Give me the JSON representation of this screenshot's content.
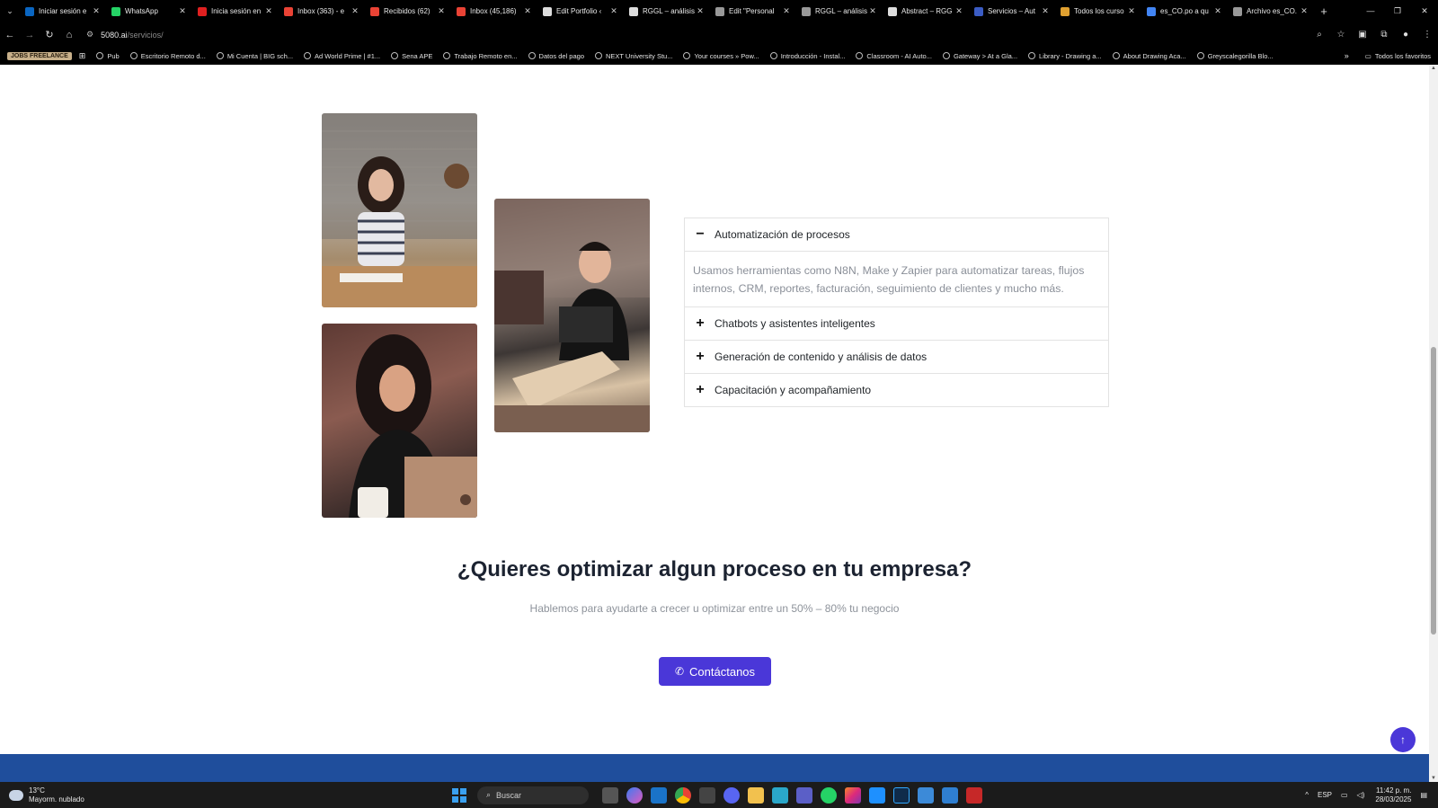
{
  "browser": {
    "tabs": [
      {
        "title": "Iniciar sesión e",
        "icon": "linkedin-icon",
        "color": "#0a66c2"
      },
      {
        "title": "WhatsApp",
        "icon": "whatsapp-icon",
        "color": "#25d366"
      },
      {
        "title": "Inicia sesión en",
        "icon": "red-logo-icon",
        "color": "#e02020"
      },
      {
        "title": "Inbox (363) - e",
        "icon": "gmail-icon",
        "color": "#ea4335"
      },
      {
        "title": "Recibidos (62)",
        "icon": "gmail-icon",
        "color": "#ea4335"
      },
      {
        "title": "Inbox (45,186)",
        "icon": "gmail-icon",
        "color": "#ea4335"
      },
      {
        "title": "Edit Portfolio ‹",
        "icon": "document-icon",
        "color": "#dddddd"
      },
      {
        "title": "RGGL – análisis",
        "icon": "document-icon",
        "color": "#dddddd"
      },
      {
        "title": "Edit \"Personal",
        "icon": "globe-icon",
        "color": "#999999"
      },
      {
        "title": "RGGL – análisis",
        "icon": "globe-icon",
        "color": "#999999"
      },
      {
        "title": "Abstract – RGG",
        "icon": "document-icon",
        "color": "#dddddd"
      },
      {
        "title": "Servicios – Aut",
        "icon": "grid-icon",
        "color": "#3b5cc4"
      },
      {
        "title": "Todos los curso",
        "icon": "course-icon",
        "color": "#e0a030"
      },
      {
        "title": "es_CO.po a qu",
        "icon": "google-icon",
        "color": "#4285f4"
      },
      {
        "title": "Archivo es_CO.",
        "icon": "globe-icon",
        "color": "#999999"
      }
    ],
    "url_host": "5080.ai",
    "url_path": "/servicios/",
    "bookmarks_badge": "JOBS FREELANCE",
    "bookmarks": [
      "Pub",
      "Escritorio Remoto d...",
      "Mi Cuenta | BIG sch...",
      "Ad World Prime | #1...",
      "Sena APE",
      "Trabajo Remoto en...",
      "Datos del pago",
      "NEXT University Stu...",
      "Your courses » Pow...",
      "Introducción - Instal...",
      "Classroom - AI Auto...",
      "Gateway > At a Gla...",
      "Library - Drawing a...",
      "About Drawing Aca...",
      "Greyscalegorilla Blo..."
    ],
    "bookmarks_all": "Todos los favoritos"
  },
  "services": {
    "items": [
      {
        "title": "Automatización de procesos",
        "sign": "−",
        "open": true,
        "body": "Usamos herramientas como N8N, Make y Zapier para automatizar tareas, flujos internos, CRM, reportes, facturación, seguimiento de clientes y mucho más."
      },
      {
        "title": "Chatbots y asistentes inteligentes",
        "sign": "+",
        "open": false
      },
      {
        "title": "Generación de contenido y análisis de datos",
        "sign": "+",
        "open": false
      },
      {
        "title": "Capacitación y acompañamiento",
        "sign": "+",
        "open": false
      }
    ]
  },
  "cta": {
    "title": "¿Quieres optimizar algun proceso en tu empresa?",
    "subtitle": "Hablemos para ayudarte a crecer u optimizar entre un 50% – 80% tu negocio",
    "button_label": "Contáctanos"
  },
  "taskbar": {
    "temperature": "13°C",
    "weather": "Mayorm. nublado",
    "search_label": "Buscar",
    "language": "ESP",
    "time": "11:42 p. m.",
    "date": "28/03/2025"
  },
  "colors": {
    "accent": "#4a37d8",
    "footer": "#1f4e9c"
  }
}
